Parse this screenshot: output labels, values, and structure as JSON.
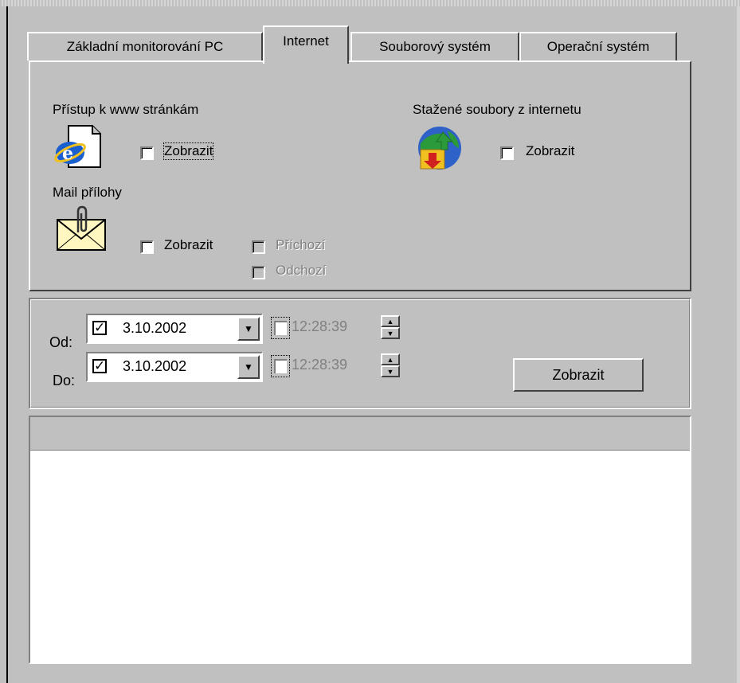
{
  "tabs": [
    {
      "label": "Základní monitorování PC",
      "active": false
    },
    {
      "label": "Internet",
      "active": true
    },
    {
      "label": "Souborový systém",
      "active": false
    },
    {
      "label": "Operační systém",
      "active": false
    }
  ],
  "www_section": {
    "title": "Přístup k www stránkám",
    "icon": "internet-explorer-icon",
    "show_label": "Zobrazit",
    "checked": false
  },
  "downloads_section": {
    "title": "Stažené soubory z internetu",
    "icon": "globe-download-icon",
    "show_label": "Zobrazit",
    "checked": false
  },
  "mail_section": {
    "title": "Mail přílohy",
    "icon": "mail-attachment-icon",
    "show_label": "Zobrazit",
    "checked": false,
    "incoming_label": "Příchozí",
    "outgoing_label": "Odchozí"
  },
  "date_range": {
    "from_label": "Od:",
    "to_label": "Do:",
    "from_date": "3.10.2002",
    "to_date": "3.10.2002",
    "from_date_checked": true,
    "to_date_checked": true,
    "check_mark": "✓",
    "from_time": "12:28:39",
    "to_time": "12:28:39"
  },
  "show_button": "Zobrazit",
  "colors": {
    "face": "#c0c0c0",
    "highlight": "#ffffff",
    "shadow": "#808080",
    "dark_shadow": "#404040",
    "window": "#ffffff"
  }
}
